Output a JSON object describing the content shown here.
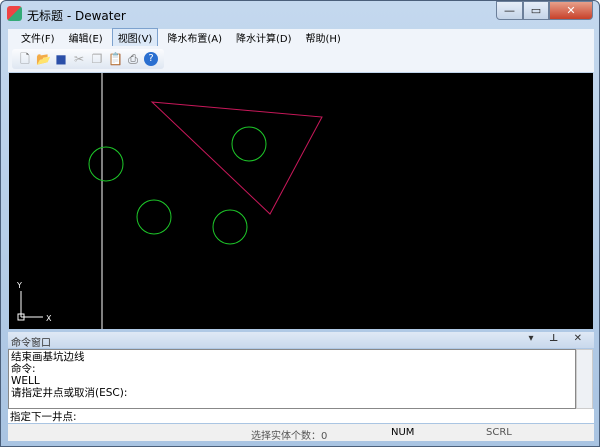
{
  "window": {
    "title": "无标题 - Dewater",
    "controls": [
      "—",
      "▭",
      "✕"
    ]
  },
  "menu": [
    "文件(F)",
    "编辑(E)",
    "视图(V)",
    "降水布置(A)",
    "降水计算(D)",
    "帮助(H)"
  ],
  "toolbar_icons": [
    "new-icon",
    "open-icon",
    "save-icon",
    "cut-icon",
    "copy-icon",
    "paste-icon",
    "print-icon",
    "help-icon"
  ],
  "canvas": {
    "axis_y": "Y",
    "axis_x": "X",
    "colors": {
      "triangle": "#c8185a",
      "circles": "#1ecb2a"
    }
  },
  "command": {
    "title": "命令窗口",
    "buttons": "▾ ⊥ ✕",
    "output": "结束画基坑边线\n命令:\nWELL\n请指定井点或取消(ESC):",
    "input": "指定下一井点:"
  },
  "status": {
    "selection": "选择实体个数：0",
    "num": "NUM",
    "scrl": "SCRL"
  }
}
